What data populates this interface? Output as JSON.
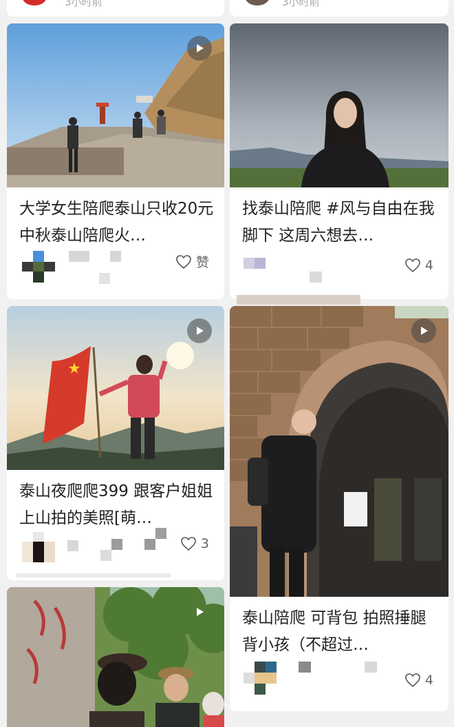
{
  "top_row": {
    "left_time": "3小时前",
    "right_time": "3小时前"
  },
  "posts": [
    {
      "title": "大学女生陪爬泰山只收20元 中秋泰山陪爬火…",
      "like_text": "赞",
      "has_video": true
    },
    {
      "title": "找泰山陪爬 #风与自由在我脚下 这周六想去…",
      "like_text": "4",
      "has_video": false
    },
    {
      "title": "泰山夜爬爬399 跟客户姐姐上山拍的美照[萌…",
      "like_text": "3",
      "has_video": true
    },
    {
      "title": "泰山陪爬 可背包 拍照捶腿 背小孩（不超过…",
      "like_text": "4",
      "has_video": true
    },
    {
      "title": "",
      "like_text": "",
      "has_video": true
    }
  ],
  "icons": {
    "play": "play-icon",
    "heart": "heart-outline-icon"
  },
  "colors": {
    "background": "#f1f1f1",
    "card": "#ffffff",
    "text": "#222222",
    "meta_text": "#666666"
  }
}
